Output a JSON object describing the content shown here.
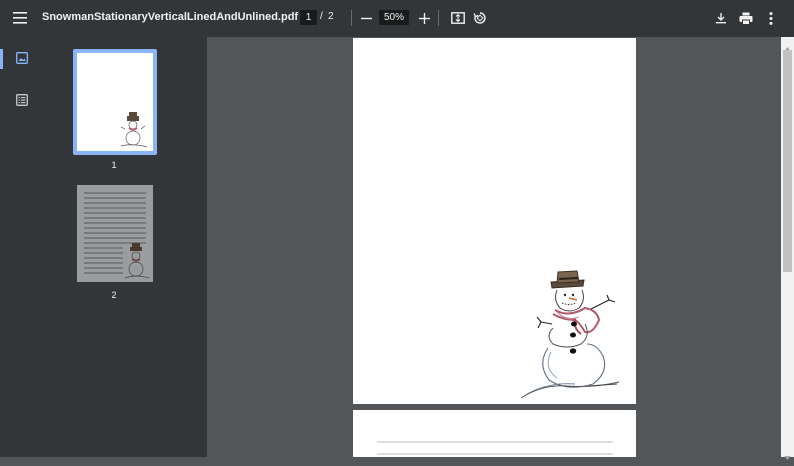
{
  "toolbar": {
    "menu_icon": "hamburger-menu-icon",
    "file_name": "SnowmanStationaryVerticalLinedAndUnlined.pdf",
    "current_page": "1",
    "page_separator": "/",
    "total_pages": "2",
    "zoom_out_icon": "minus-icon",
    "zoom_level": "50%",
    "zoom_in_icon": "plus-icon",
    "fit_page_icon": "fit-to-page-icon",
    "rotate_icon": "rotate-icon",
    "download_icon": "download-icon",
    "print_icon": "print-icon",
    "more_icon": "more-vert-icon"
  },
  "sidebar": {
    "rail": [
      {
        "icon": "thumbnails-icon",
        "active": true
      },
      {
        "icon": "outline-icon",
        "active": false
      }
    ],
    "thumbnails": [
      {
        "label": "1",
        "selected": true
      },
      {
        "label": "2",
        "selected": false
      }
    ]
  },
  "colors": {
    "toolbar_bg": "#323639",
    "viewer_bg": "#525659",
    "accent": "#8ab4f8"
  }
}
